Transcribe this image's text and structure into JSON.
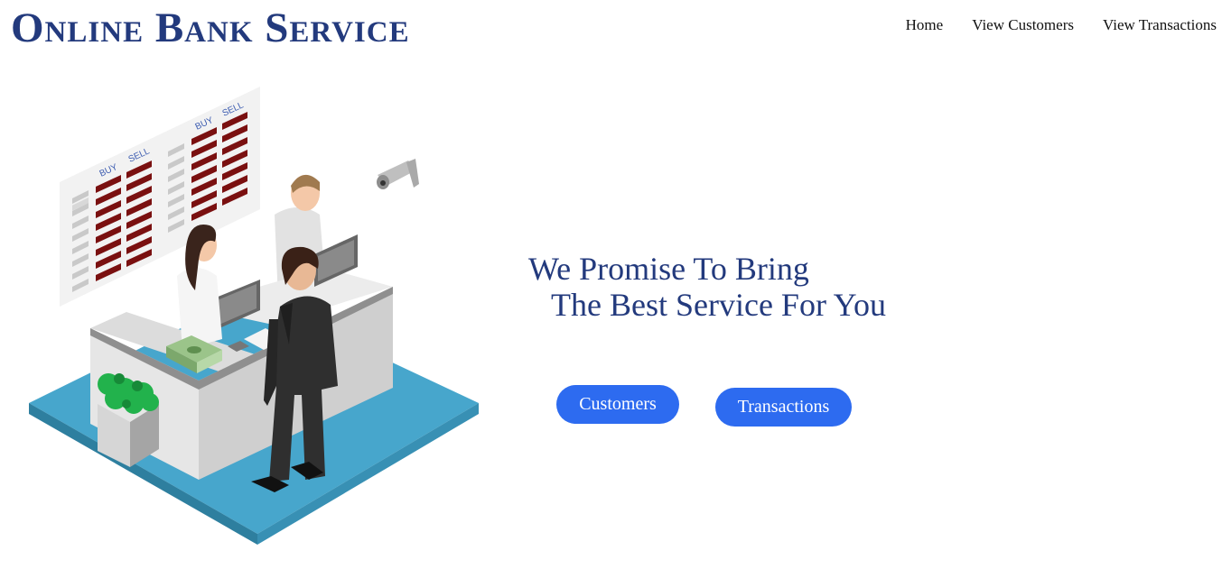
{
  "header": {
    "brand": "Online Bank Service",
    "nav": [
      "Home",
      "View Customers",
      "View Transactions"
    ]
  },
  "hero": {
    "line1": "We Promise To Bring",
    "line2": "The Best Service For You",
    "buttons": {
      "customers": "Customers",
      "transactions": "Transactions"
    },
    "board_labels": {
      "buy": "BUY",
      "sell": "SELL"
    }
  },
  "colors": {
    "brand": "#233a7d",
    "button": "#2d6bf0",
    "platform": "#47a6cc",
    "board_digits": "#8b1a1a"
  },
  "icons": [
    "bank-counter-illustration",
    "security-camera-icon",
    "plant-icon",
    "cash-stack-icon"
  ]
}
